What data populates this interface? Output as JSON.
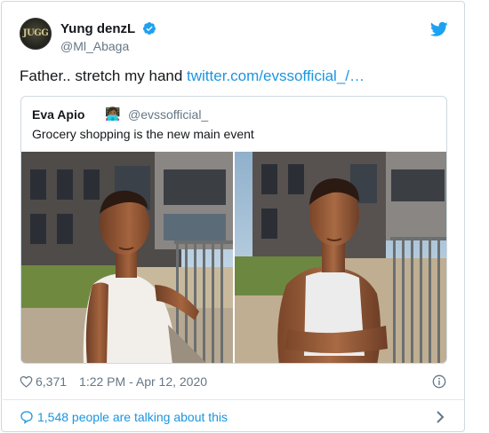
{
  "tweet": {
    "author": {
      "name": "Yung denzL",
      "handle": "@Ml_Abaga",
      "avatar_text": "JUGG"
    },
    "text": "Father.. stretch my hand ",
    "link_text": "twitter.com/evssofficial_/…",
    "likes": "6,371",
    "timestamp": "1:22 PM - Apr 12, 2020",
    "talking": "1,548 people are talking about this"
  },
  "quoted": {
    "name": "Eva Apio",
    "emoji": "👩🏾‍💻",
    "handle": "@evssofficial_",
    "text": "Grocery shopping is the new main event"
  },
  "colors": {
    "accent": "#1b95e0",
    "muted": "#657786",
    "border": "#cfd9de",
    "verified": "#1da1f2"
  },
  "icons": [
    "twitter-bird-icon",
    "verified-badge-icon",
    "heart-icon",
    "info-icon",
    "speech-bubble-icon",
    "chevron-right-icon"
  ]
}
